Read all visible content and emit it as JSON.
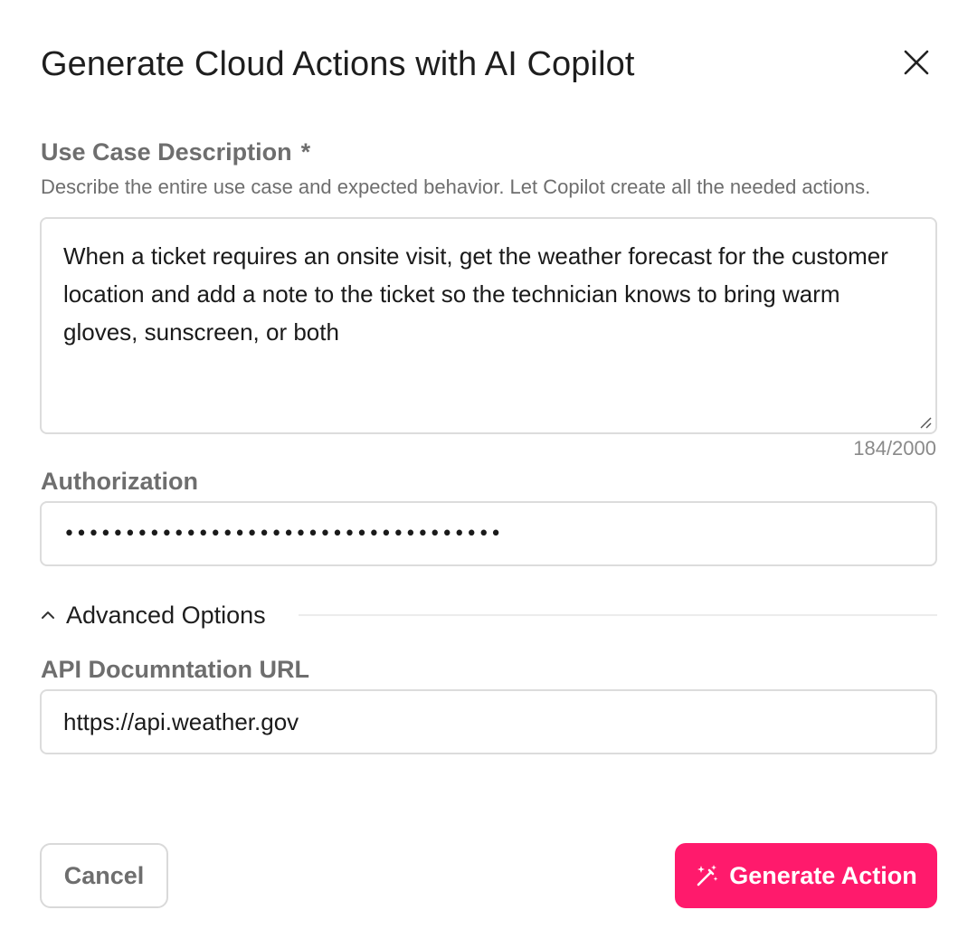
{
  "dialog": {
    "title": "Generate Cloud Actions with AI Copilot"
  },
  "use_case": {
    "label": "Use Case Description",
    "required_mark": "*",
    "help_text": "Describe the entire use case and expected behavior. Let Copilot create all the needed actions.",
    "value": "When a ticket requires an onsite visit, get the weather forecast for the customer location and add a note to the ticket so the technician knows to bring warm gloves, sunscreen, or both",
    "counter": "184/2000"
  },
  "authorization": {
    "label": "Authorization",
    "masked_value": "••••••••••••••••••••••••••••••••••••"
  },
  "advanced": {
    "label": "Advanced Options",
    "expanded": true
  },
  "api_docs": {
    "label": "API Documntation URL",
    "value": "https://api.weather.gov"
  },
  "footer": {
    "cancel_label": "Cancel",
    "generate_label": "Generate Action"
  },
  "icons": {
    "close": "close-icon",
    "chevron": "chevron-up-icon",
    "wand": "magic-wand-icon",
    "resize": "resize-handle-icon"
  },
  "colors": {
    "accent": "#ff1a6c",
    "label_gray": "#6e6e6e",
    "border": "#dcdcdc"
  }
}
